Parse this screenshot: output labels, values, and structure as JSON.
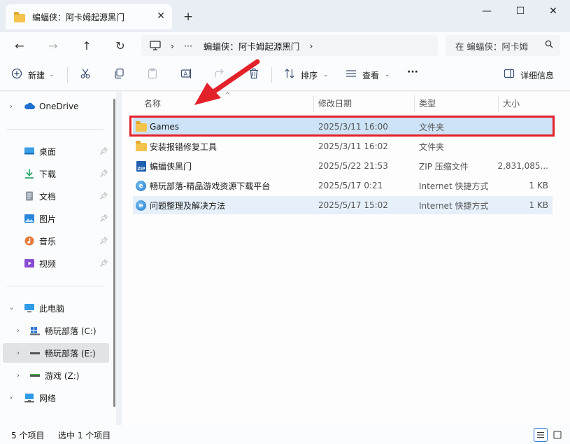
{
  "window": {
    "tab_title": "蝙蝠侠：阿卡姆起源黑门",
    "new_tab_symbol": "+",
    "close_tab_symbol": "✕",
    "minimize_symbol": "—",
    "maximize_symbol": "☐",
    "close_symbol": "✕"
  },
  "nav": {
    "back_symbol": "←",
    "forward_symbol": "→",
    "up_symbol": "↑",
    "refresh_symbol": "↻",
    "address_more": "···",
    "address_sep": "›",
    "address_path": "蝙蝠侠：阿卡姆起源黑门",
    "search_placeholder": "在 蝙蝠侠：阿卡姆",
    "search_icon": "search-icon"
  },
  "toolbar": {
    "new_label": "新建",
    "sort_label": "排序",
    "view_label": "查看",
    "more_label": "···",
    "details_label": "详细信息"
  },
  "sidebar": {
    "onedrive": "OneDrive",
    "quick": [
      {
        "label": "桌面",
        "icon": "desktop-icon"
      },
      {
        "label": "下载",
        "icon": "download-icon"
      },
      {
        "label": "文档",
        "icon": "document-icon"
      },
      {
        "label": "图片",
        "icon": "picture-icon"
      },
      {
        "label": "音乐",
        "icon": "music-icon"
      },
      {
        "label": "视频",
        "icon": "video-icon"
      }
    ],
    "this_pc": "此电脑",
    "drives": [
      {
        "label": "畅玩部落 (C:)"
      },
      {
        "label": "畅玩部落 (E:)"
      },
      {
        "label": "游戏 (Z:)"
      }
    ],
    "network": "网络"
  },
  "columns": {
    "name": "名称",
    "date": "修改日期",
    "type": "类型",
    "size": "大小"
  },
  "files": [
    {
      "name": "Games",
      "date": "2025/3/11 16:00",
      "type": "文件夹",
      "size": "",
      "icon": "folder-icon"
    },
    {
      "name": "安装报错修复工具",
      "date": "2025/3/11 16:02",
      "type": "文件夹",
      "size": "",
      "icon": "folder-icon"
    },
    {
      "name": "蝙蝠侠黑门",
      "date": "2025/5/22 21:53",
      "type": "ZIP 压缩文件",
      "size": "2,831,085...",
      "icon": "zip-icon"
    },
    {
      "name": "畅玩部落-精品游戏资源下载平台",
      "date": "2025/5/17 0:21",
      "type": "Internet 快捷方式",
      "size": "1 KB",
      "icon": "internet-shortcut-icon"
    },
    {
      "name": "问题整理及解决方法",
      "date": "2025/5/17 15:02",
      "type": "Internet 快捷方式",
      "size": "1 KB",
      "icon": "internet-shortcut-icon"
    }
  ],
  "status": {
    "item_count": "5 个项目",
    "selected_count": "选中 1 个项目"
  },
  "colors": {
    "highlight_border": "#e32129",
    "arrow": "#e32129",
    "selected_row": "#cde3f7"
  }
}
